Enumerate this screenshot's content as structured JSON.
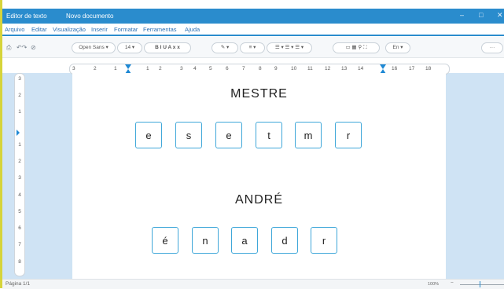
{
  "window": {
    "app_title": "Editor de texto",
    "doc_title": "Novo documento",
    "minimize_glyph": "–",
    "maximize_glyph": "□",
    "close_glyph": "✕"
  },
  "menu": [
    "Arquivo",
    "Editar",
    "Visualização",
    "Inserir",
    "Formatar",
    "Ferramentas",
    "Ajuda"
  ],
  "toolbar": {
    "font": "Open Sans",
    "size": "14",
    "format_buttons": "B I U A x x",
    "language": "En",
    "more": "···"
  },
  "ruler_top": [
    "3",
    "2",
    "1",
    "1",
    "2",
    "3",
    "4",
    "5",
    "6",
    "7",
    "8",
    "9",
    "10",
    "11",
    "12",
    "13",
    "14",
    "16",
    "17",
    "18"
  ],
  "ruler_left": [
    "3",
    "2",
    "1",
    "1",
    "2",
    "3",
    "4",
    "5",
    "6",
    "7",
    "8"
  ],
  "exercises": [
    {
      "word": "MESTRE",
      "letters": [
        "e",
        "s",
        "e",
        "t",
        "m",
        "r"
      ]
    },
    {
      "word": "ANDRÉ",
      "letters": [
        "é",
        "n",
        "a",
        "d",
        "r"
      ]
    }
  ],
  "status": {
    "page": "Página 1/1",
    "zoom": "100%",
    "zoom_minus": "−"
  },
  "colors": {
    "titlebar": "#2a8ccd",
    "tile_border": "#3fa7d9",
    "side_bg": "#cfe3f4",
    "accent_marker": "#1e88d4"
  }
}
